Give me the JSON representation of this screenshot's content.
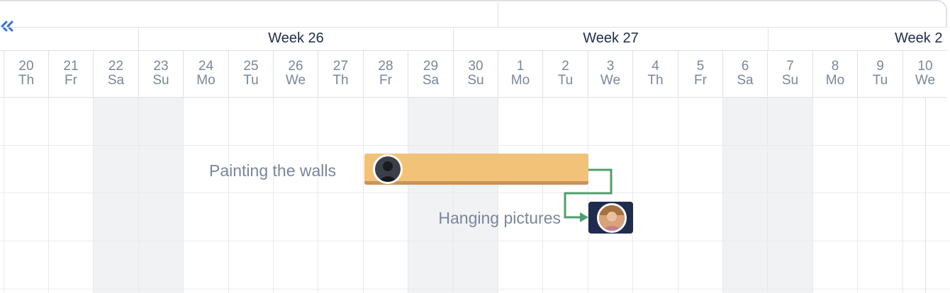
{
  "collapse_icon": "double-chevron-left-icon",
  "weeks": [
    "Week 26",
    "Week 27",
    "Week 2"
  ],
  "days": [
    {
      "num": "20",
      "dow": "Th",
      "weekend": false
    },
    {
      "num": "21",
      "dow": "Fr",
      "weekend": false
    },
    {
      "num": "22",
      "dow": "Sa",
      "weekend": true
    },
    {
      "num": "23",
      "dow": "Su",
      "weekend": true
    },
    {
      "num": "24",
      "dow": "Mo",
      "weekend": false
    },
    {
      "num": "25",
      "dow": "Tu",
      "weekend": false
    },
    {
      "num": "26",
      "dow": "We",
      "weekend": false
    },
    {
      "num": "27",
      "dow": "Th",
      "weekend": false
    },
    {
      "num": "28",
      "dow": "Fr",
      "weekend": false
    },
    {
      "num": "29",
      "dow": "Sa",
      "weekend": true
    },
    {
      "num": "30",
      "dow": "Su",
      "weekend": true
    },
    {
      "num": "1",
      "dow": "Mo",
      "weekend": false
    },
    {
      "num": "2",
      "dow": "Tu",
      "weekend": false
    },
    {
      "num": "3",
      "dow": "We",
      "weekend": false
    },
    {
      "num": "4",
      "dow": "Th",
      "weekend": false
    },
    {
      "num": "5",
      "dow": "Fr",
      "weekend": false
    },
    {
      "num": "6",
      "dow": "Sa",
      "weekend": true
    },
    {
      "num": "7",
      "dow": "Su",
      "weekend": true
    },
    {
      "num": "8",
      "dow": "Mo",
      "weekend": false
    },
    {
      "num": "9",
      "dow": "Tu",
      "weekend": false
    },
    {
      "num": "10",
      "dow": "We",
      "weekend": false
    }
  ],
  "tasks": [
    {
      "name": "Painting the walls",
      "color": "#f2c279",
      "avatar_icon": "user-avatar-dark"
    },
    {
      "name": "Hanging pictures",
      "color": "#1f2c4d",
      "avatar_icon": "user-avatar-light"
    }
  ],
  "colors": {
    "accent": "#2f6fdb",
    "dependency": "#4f9e6e",
    "weekend": "#f1f2f4",
    "text": "#7a869a",
    "heading": "#1f2c4d"
  }
}
